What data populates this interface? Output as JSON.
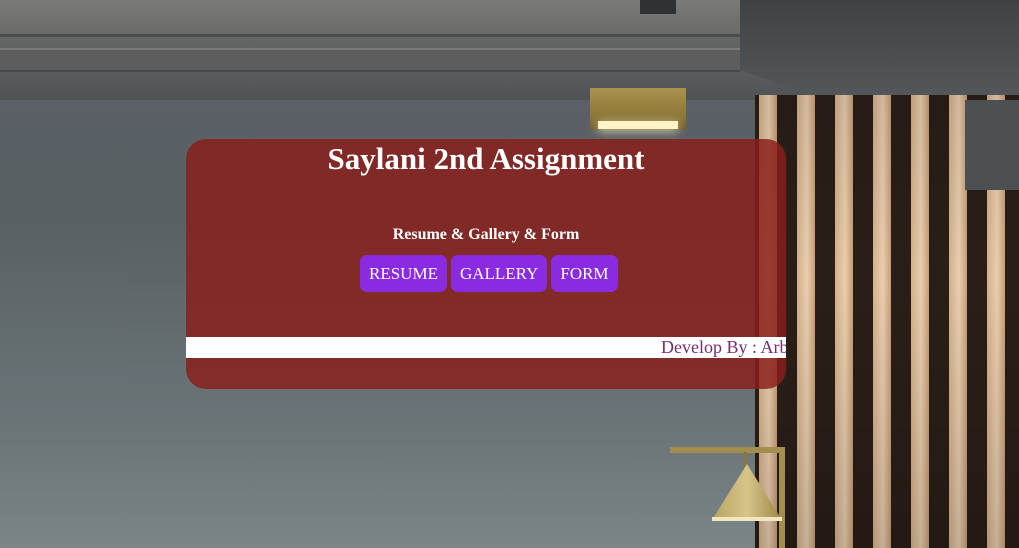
{
  "card": {
    "title": "Saylani 2nd Assignment",
    "subtitle": "Resume & Gallery & Form",
    "background_color": "#891e1a",
    "buttons": [
      {
        "label": "RESUME"
      },
      {
        "label": "GALLERY"
      },
      {
        "label": "FORM"
      }
    ],
    "button_color": "#8a2be2",
    "marquee": {
      "text": "Develop By : Arb",
      "text_color": "#7a2a6e"
    }
  }
}
